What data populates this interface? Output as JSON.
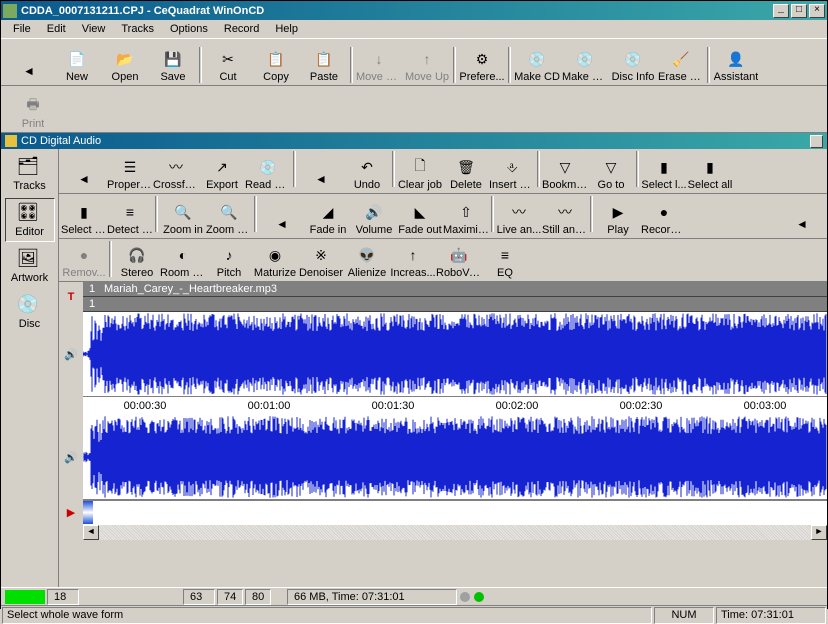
{
  "titlebar": {
    "text": "CDDA_0007131211.CPJ - CeQuadrat WinOnCD"
  },
  "menu": [
    "File",
    "Edit",
    "View",
    "Tracks",
    "Options",
    "Record",
    "Help"
  ],
  "maintoolbar": [
    {
      "label": "",
      "arrow": "◄"
    },
    {
      "label": "New"
    },
    {
      "label": "Open"
    },
    {
      "label": "Save"
    },
    {
      "sep": true
    },
    {
      "label": "Cut"
    },
    {
      "label": "Copy"
    },
    {
      "label": "Paste"
    },
    {
      "sep": true
    },
    {
      "label": "Move D...",
      "disabled": true
    },
    {
      "label": "Move Up",
      "disabled": true
    },
    {
      "sep": true
    },
    {
      "label": "Prefere..."
    },
    {
      "sep": true
    },
    {
      "label": "Make CD"
    },
    {
      "label": "Make C..."
    },
    {
      "label": "Disc Info"
    },
    {
      "label": "Erase C..."
    },
    {
      "sep": true
    },
    {
      "label": "Assistant"
    }
  ],
  "print_label": "Print",
  "inner_title": "CD Digital Audio",
  "sidebar": [
    {
      "label": "Tracks"
    },
    {
      "label": "Editor",
      "selected": true
    },
    {
      "label": "Artwork"
    },
    {
      "label": "Disc"
    }
  ],
  "editor_row1": [
    {
      "arrow": "◄"
    },
    {
      "label": "Properties"
    },
    {
      "label": "Crossfade"
    },
    {
      "label": "Export"
    },
    {
      "label": "Read C..."
    },
    {
      "sep": true
    },
    {
      "arrow": "◄"
    },
    {
      "label": "Undo"
    },
    {
      "sep": true
    },
    {
      "label": "Clear job"
    },
    {
      "label": "Delete"
    },
    {
      "label": "Insert sil..."
    },
    {
      "sep": true
    },
    {
      "label": "Bookmark"
    },
    {
      "label": "Go to"
    },
    {
      "sep": true
    },
    {
      "label": "Select l..."
    },
    {
      "label": "Select all"
    }
  ],
  "editor_row2": [
    {
      "label": "Select ri..."
    },
    {
      "label": "Detect t..."
    },
    {
      "sep": true
    },
    {
      "label": "Zoom in"
    },
    {
      "label": "Zoom out"
    },
    {
      "sep": true
    },
    {
      "arrow": "◄"
    },
    {
      "label": "Fade in"
    },
    {
      "label": "Volume"
    },
    {
      "label": "Fade out"
    },
    {
      "label": "Maximiz..."
    },
    {
      "sep": true
    },
    {
      "label": "Live an..."
    },
    {
      "label": "Still anal..."
    },
    {
      "sep": true
    },
    {
      "label": "Play"
    },
    {
      "label": "Record ..."
    },
    {
      "arrow": "◄",
      "right": true
    }
  ],
  "editor_row3": [
    {
      "label": "Remov...",
      "disabled": true
    },
    {
      "sep": true
    },
    {
      "label": "Stereo"
    },
    {
      "label": "Room si..."
    },
    {
      "label": "Pitch"
    },
    {
      "label": "Maturize"
    },
    {
      "label": "Denoiser"
    },
    {
      "label": "Alienize"
    },
    {
      "label": "Increas..."
    },
    {
      "label": "RoboVo..."
    },
    {
      "label": "EQ"
    }
  ],
  "track": {
    "num": "1",
    "name": "Mariah_Carey_-_Heartbreaker.mp3",
    "num2": "1"
  },
  "timeline": [
    "00:00:30",
    "00:01:00",
    "00:01:30",
    "00:02:00",
    "00:02:30",
    "00:03:00"
  ],
  "status1": {
    "v1": "18",
    "v2": "63",
    "v3": "74",
    "v4": "80",
    "info": "66 MB, Time: 07:31:01"
  },
  "status2": {
    "hint": "Select whole wave form",
    "ind": "NUM",
    "time": "Time: 07:31:01"
  }
}
